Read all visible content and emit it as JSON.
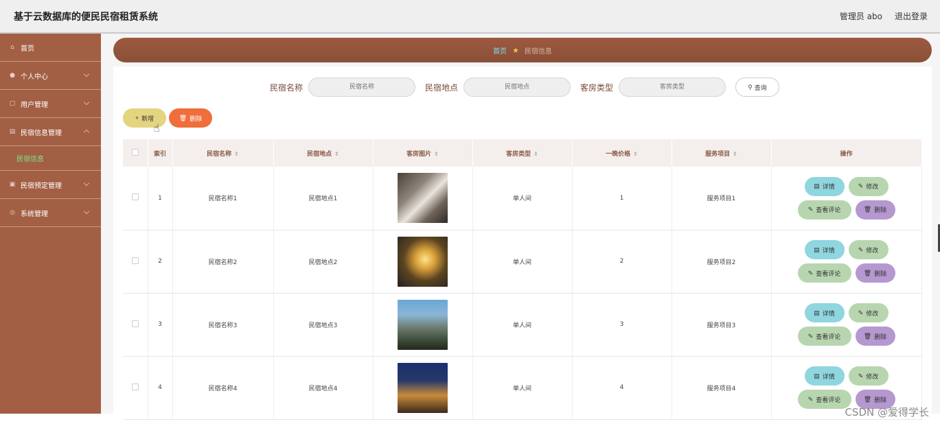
{
  "header": {
    "title": "基于云数据库的便民民宿租赁系统",
    "user": "管理员 abo",
    "logout": "退出登录"
  },
  "sidebar": {
    "items": [
      {
        "label": "首页",
        "icon": "home-icon"
      },
      {
        "label": "个人中心",
        "icon": "user-icon"
      },
      {
        "label": "用户管理",
        "icon": "users-icon"
      },
      {
        "label": "民宿信息管理",
        "icon": "info-icon",
        "sub": "民宿信息"
      },
      {
        "label": "民宿预定管理",
        "icon": "booking-icon"
      },
      {
        "label": "系统管理",
        "icon": "settings-icon"
      }
    ]
  },
  "breadcrumb": {
    "home": "首页",
    "current": "民宿信息"
  },
  "search": {
    "fields": [
      {
        "label": "民宿名称",
        "placeholder": "民宿名称"
      },
      {
        "label": "民宿地点",
        "placeholder": "民宿地点"
      },
      {
        "label": "客房类型",
        "placeholder": "客房类型"
      }
    ],
    "button": "查询"
  },
  "toolbar": {
    "add": "新增",
    "delete": "删除"
  },
  "table": {
    "columns": [
      "索引",
      "民宿名称",
      "民宿地点",
      "客房图片",
      "客房类型",
      "一晚价格",
      "服务项目",
      "操作"
    ],
    "rows": [
      {
        "index": "1",
        "name": "民宿名称1",
        "location": "民宿地点1",
        "room_type": "单人间",
        "price": "1",
        "service": "服务项目1"
      },
      {
        "index": "2",
        "name": "民宿名称2",
        "location": "民宿地点2",
        "room_type": "单人间",
        "price": "2",
        "service": "服务项目2"
      },
      {
        "index": "3",
        "name": "民宿名称3",
        "location": "民宿地点3",
        "room_type": "单人间",
        "price": "3",
        "service": "服务项目3"
      },
      {
        "index": "4",
        "name": "民宿名称4",
        "location": "民宿地点4",
        "room_type": "单人间",
        "price": "4",
        "service": "服务项目4"
      }
    ],
    "actions": {
      "detail": "详情",
      "edit": "修改",
      "review": "查看评论",
      "delete": "删除"
    }
  },
  "watermark": "CSDN @爱得学长",
  "colors": {
    "sidebar": "#a35f43",
    "breadcrumb": "#9c5a40",
    "add_button": "#e3d580",
    "delete_button": "#ef6e3c",
    "detail": "#8fd6df",
    "edit": "#b7d6b0",
    "row_delete": "#b598d0"
  }
}
